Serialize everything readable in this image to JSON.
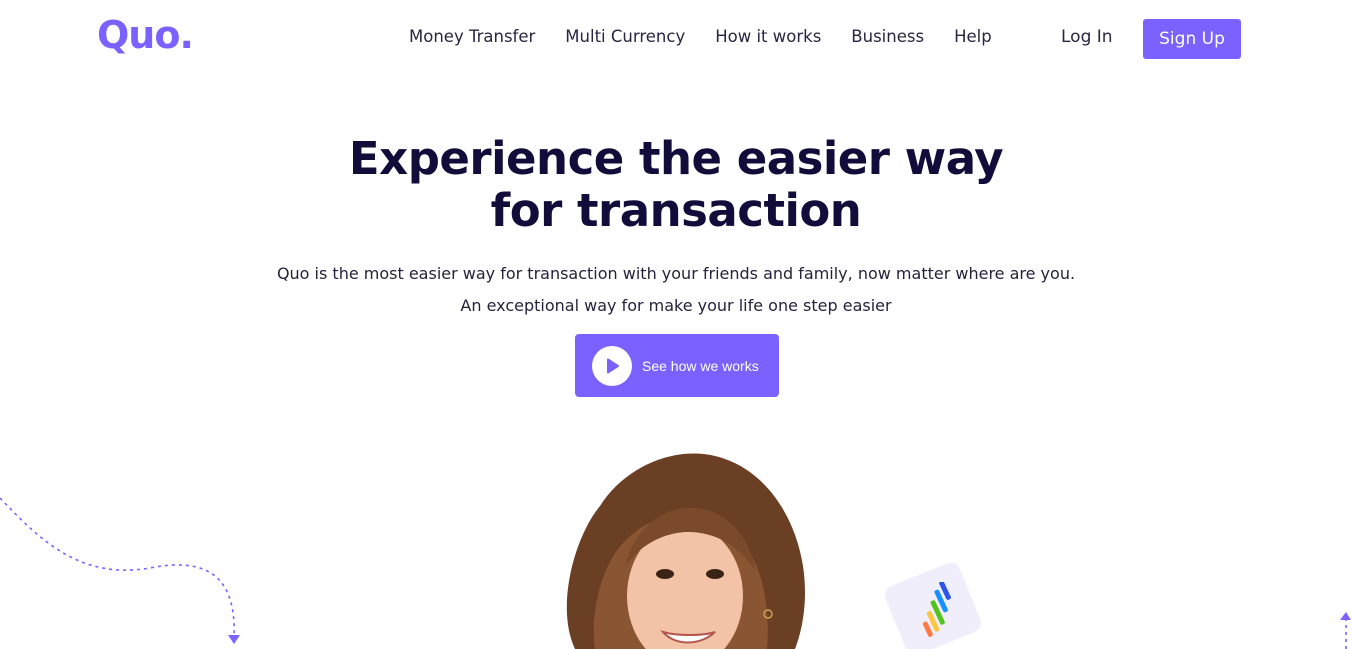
{
  "brand": {
    "logo_text": "Quo."
  },
  "nav": {
    "items": [
      {
        "label": "Money Transfer"
      },
      {
        "label": "Multi Currency"
      },
      {
        "label": "How it works"
      },
      {
        "label": "Business"
      },
      {
        "label": "Help"
      }
    ],
    "login_label": "Log In",
    "signup_label": "Sign Up"
  },
  "hero": {
    "title_line1": "Experience the easier way",
    "title_line2": "for transaction",
    "subtitle_line1": "Quo is the most easier way for transaction with your friends and family, now matter where are you.",
    "subtitle_line2": "An exceptional way for make your life one step easier",
    "cta_label": "See how we works"
  },
  "colors": {
    "accent": "#7b61ff",
    "title": "#120c3a",
    "text": "#26223c"
  },
  "icons": {
    "play": "play-icon",
    "chart": "bar-chart-icon"
  }
}
